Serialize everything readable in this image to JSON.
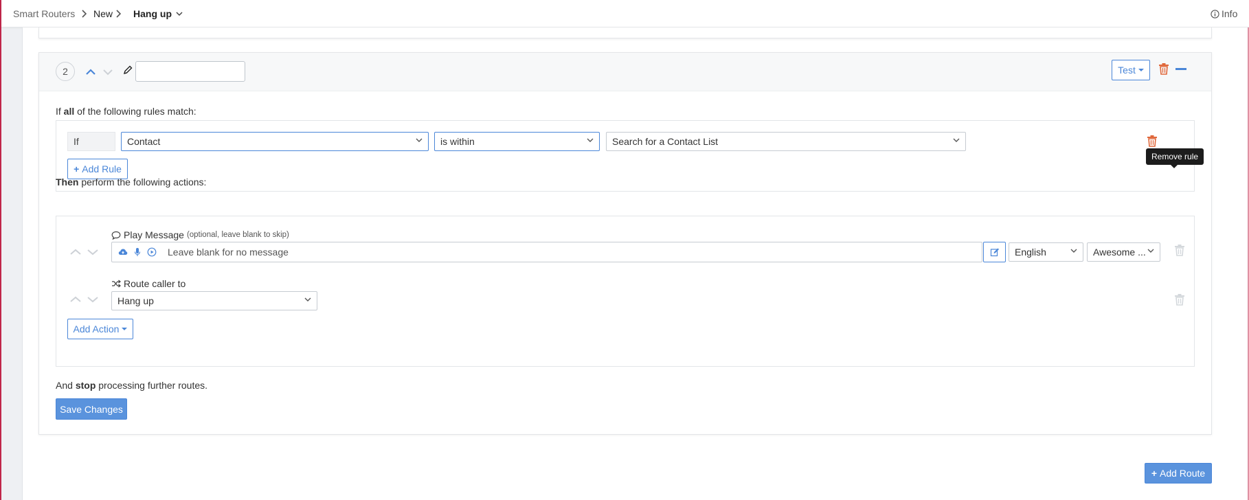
{
  "breadcrumb": {
    "root": "Smart Routers",
    "section": "New",
    "current": "Hang up",
    "info": "Info"
  },
  "route": {
    "number": "2",
    "name_value": "",
    "test_label": "Test"
  },
  "rules": {
    "heading_prefix": "If ",
    "heading_bold": "all",
    "heading_suffix": " of the following rules match:",
    "if_label": "If",
    "field_value": "Contact",
    "operator_value": "is within",
    "target_placeholder": "Search for a Contact List",
    "add_rule_label": "Add Rule",
    "remove_tooltip": "Remove rule"
  },
  "actions": {
    "heading_bold": "Then",
    "heading_suffix": " perform the following actions:",
    "play_message_label": "Play Message",
    "play_message_hint": "(optional, leave blank to skip)",
    "message_placeholder": "Leave blank for no message",
    "language_value": "English",
    "voice_value": "Awesome ...",
    "route_label": "Route caller to",
    "route_value": "Hang up",
    "add_action_label": "Add Action"
  },
  "footer": {
    "stop_prefix": "And ",
    "stop_bold": "stop",
    "stop_suffix": " processing further routes.",
    "save_label": "Save Changes",
    "add_route_label": "Add Route"
  },
  "colors": {
    "accent": "#4a86d8",
    "primary_button": "#5a93dd",
    "danger": "#e0673a",
    "brand_edge": "#c0264a"
  }
}
